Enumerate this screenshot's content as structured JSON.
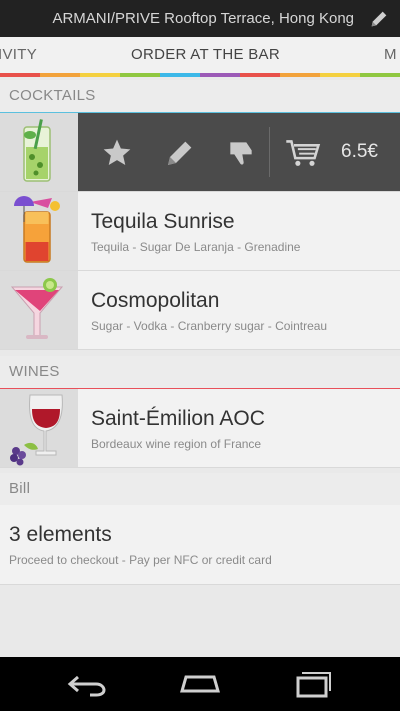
{
  "header": {
    "title": "ARMANI/PRIVE Rooftop Terrace, Hong Kong",
    "edit_icon": "pencil-icon"
  },
  "tabs": [
    {
      "label": "IVITY"
    },
    {
      "label": "ORDER AT THE BAR",
      "active": true
    },
    {
      "label": "M"
    }
  ],
  "tab_stripe_colors": [
    "#e8504a",
    "#f2a23a",
    "#f4d03f",
    "#8fc740",
    "#3cb8e8",
    "#9b59b6",
    "#e8504a",
    "#f2a23a",
    "#f4d03f",
    "#8fc740"
  ],
  "sections": {
    "cocktails": {
      "label": "COCKTAILS",
      "line_color": "#5bc0de"
    },
    "wines": {
      "label": "WINES",
      "line_color": "#e8505a"
    },
    "bill": {
      "label": "Bill",
      "line_color": "#c3d86a"
    }
  },
  "selected_item": {
    "thumb_icon": "mojito-glass-icon",
    "actions": [
      {
        "icon": "star-icon"
      },
      {
        "icon": "pencil-icon"
      },
      {
        "icon": "thumbs-down-icon"
      },
      {
        "icon": "cart-icon"
      }
    ],
    "price": "6.5€"
  },
  "cocktails": [
    {
      "name": "Tequila Sunrise",
      "desc": "Tequila - Sugar De Laranja - Grenadine",
      "icon": "tequila-sunrise-icon"
    },
    {
      "name": "Cosmopolitan",
      "desc": "Sugar - Vodka - Cranberry sugar - Cointreau",
      "icon": "cosmopolitan-icon"
    }
  ],
  "wines": [
    {
      "name": "Saint-Émilion AOC",
      "desc": "Bordeaux wine region of France",
      "icon": "red-wine-icon"
    }
  ],
  "bill": {
    "name": "3 elements",
    "desc": "Proceed to checkout - Pay per NFC or credit card"
  },
  "navbar": {
    "back": "back-icon",
    "home": "home-icon",
    "recents": "recents-icon"
  }
}
